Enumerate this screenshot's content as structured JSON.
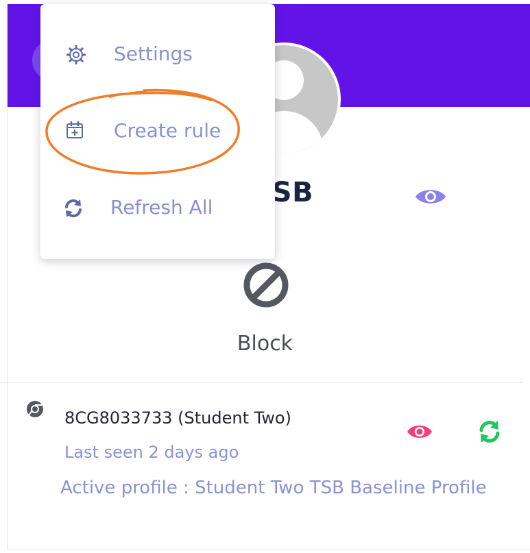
{
  "profile": {
    "name_partial": "vo TSB"
  },
  "status": {
    "label": "Block"
  },
  "menu": {
    "items": [
      {
        "label": "Settings",
        "icon": "gear-icon"
      },
      {
        "label": "Create rule",
        "icon": "calendar-plus-icon"
      },
      {
        "label": "Refresh All",
        "icon": "refresh-icon"
      }
    ]
  },
  "device": {
    "name": "8CG8033733 (Student Two)",
    "last_seen": "Last seen 2 days ago",
    "active_profile": "Active profile : Student Two TSB Baseline Profile",
    "icon": "chrome-icon"
  },
  "colors": {
    "banner": "#6214e8",
    "menu_text": "#8891d0",
    "annotation": "#ee7d2c",
    "eye_pink": "#f43f7a",
    "refresh_green": "#22c55e",
    "name_eye": "#8a82e8"
  }
}
